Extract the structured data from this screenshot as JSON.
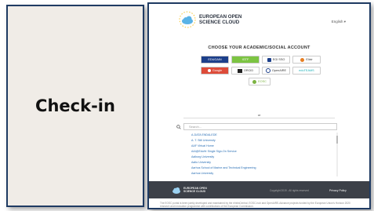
{
  "label": {
    "text": "Check-in"
  },
  "header": {
    "logo_line1": "EUROPEAN OPEN",
    "logo_line2": "SCIENCE CLOUD",
    "language": "English ▾"
  },
  "choose_title": "CHOOSE YOUR ACADEMIC/SOCIAL ACCOUNT",
  "providers": [
    {
      "label": "EDUGAIN",
      "bg": "#1c3f8a",
      "fg": "#ffffff"
    },
    {
      "label": "IGTF",
      "bg": "#7cc442",
      "fg": "#ffffff"
    },
    {
      "label": "EGI SSO",
      "bg": "#ffffff",
      "fg": "#333333"
    },
    {
      "label": "Elixir",
      "bg": "#ffffff",
      "fg": "#333333"
    },
    {
      "label": "Google",
      "bg": "#dd4b39",
      "fg": "#ffffff"
    },
    {
      "label": "ORCID",
      "bg": "#ffffff",
      "fg": "#333333"
    },
    {
      "label": "OpenAIRE",
      "bg": "#ffffff",
      "fg": "#333333"
    },
    {
      "label": "eduTEAMS",
      "bg": "#ffffff",
      "fg": "#1bb0b8"
    },
    {
      "label": "EOSC",
      "bg": "#ffffff",
      "fg": "#7cb342"
    }
  ],
  "or_text": "or",
  "search": {
    "placeholder": "Search..."
  },
  "institutions": [
    "A-DATA ENDALEDE",
    "A. T. Still University",
    "AAF Virtual Home",
    "AAI@EduHr Single Sign-On Service",
    "Aalborg University",
    "Aalto University",
    "Aarhus School of Marine and Technical Engineering",
    "Aarhus University",
    "Aberdeen University"
  ],
  "footer": {
    "logo_line1": "EUROPEAN OPEN",
    "logo_line2": "SCIENCE CLOUD",
    "copyright": "Copyright 2019 - All rights reserved",
    "privacy": "Privacy Policy"
  },
  "disclaimer": "The EOSC portal is been jointly developed and maintained by the eInfraCentral, EOSC-hub and OpenAIRE-Advance projects funded by the European Union's Horizon 2020 research and innovation programme with contributions of the European Commission."
}
